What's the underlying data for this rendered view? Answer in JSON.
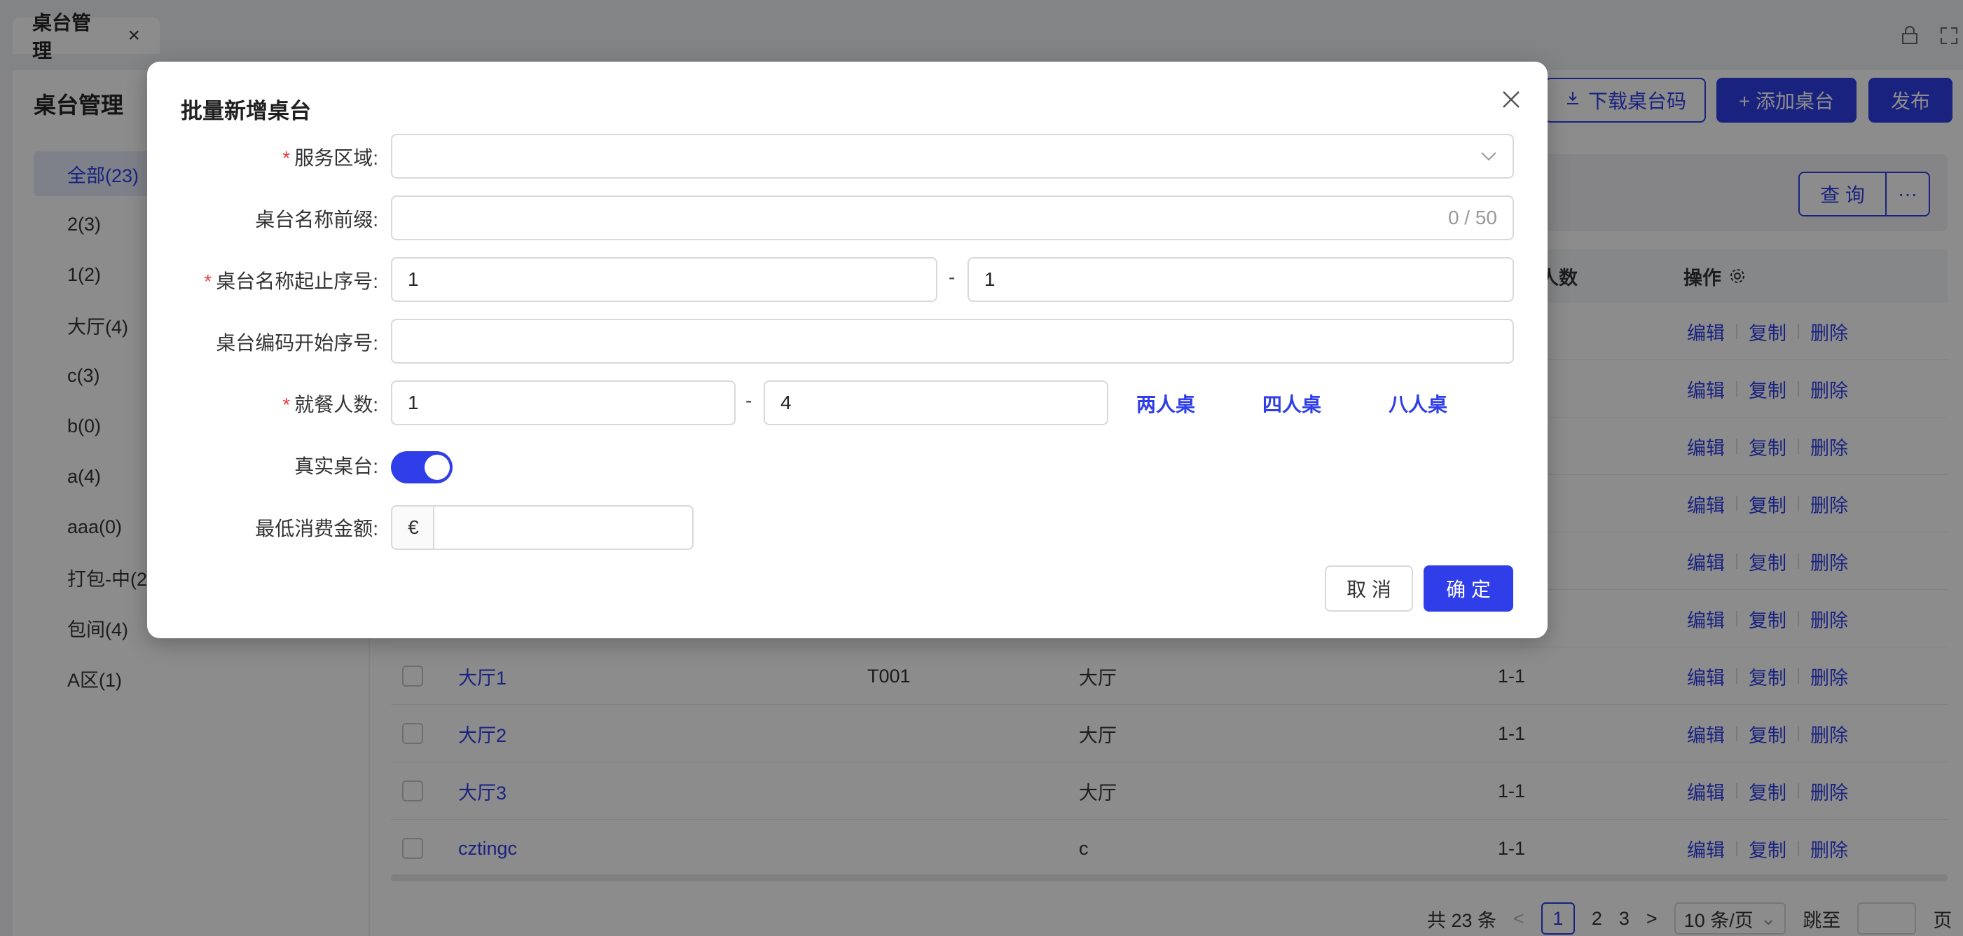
{
  "tabbar": {
    "active_tab": "桌台管理",
    "close_glyph": "×",
    "right_icon_1": "lock-icon",
    "right_icon_2": "fullscreen-icon"
  },
  "sidebar": {
    "title": "桌台管理",
    "items": [
      {
        "label": "全部(23)",
        "active": true
      },
      {
        "label": "2(3)"
      },
      {
        "label": "1(2)"
      },
      {
        "label": "大厅(4)"
      },
      {
        "label": "c(3)"
      },
      {
        "label": "b(0)"
      },
      {
        "label": "a(4)"
      },
      {
        "label": "aaa(0)"
      },
      {
        "label": "打包-中(2"
      },
      {
        "label": "包间(4)"
      },
      {
        "label": "A区(1)"
      }
    ]
  },
  "toolbar": {
    "download_label": "下载桌台码",
    "add_label": "+ 添加桌台",
    "publish_label": "发布"
  },
  "filter": {
    "query_label": "查 询",
    "more_label": "···"
  },
  "table": {
    "headers": {
      "people": "人数",
      "ops": "操作"
    },
    "op_labels": [
      "编辑",
      "复制",
      "删除"
    ],
    "rows": [
      {
        "name": "",
        "code": "",
        "area": "",
        "people": ""
      },
      {
        "name": "",
        "code": "",
        "area": "",
        "people": ""
      },
      {
        "name": "",
        "code": "",
        "area": "",
        "people": ""
      },
      {
        "name": "",
        "code": "",
        "area": "",
        "people": ""
      },
      {
        "name": "",
        "code": "",
        "area": "",
        "people": ""
      },
      {
        "name": "",
        "code": "",
        "area": "",
        "people": ""
      },
      {
        "name": "大厅1",
        "code": "T001",
        "area": "大厅",
        "people": "1-1"
      },
      {
        "name": "大厅2",
        "code": "",
        "area": "大厅",
        "people": "1-1"
      },
      {
        "name": "大厅3",
        "code": "",
        "area": "大厅",
        "people": "1-1"
      },
      {
        "name": "cztingc",
        "code": "",
        "area": "c",
        "people": "1-1"
      }
    ]
  },
  "pagination": {
    "total": "共 23 条",
    "prev": "<",
    "pages": [
      "1",
      "2",
      "3"
    ],
    "current": "1",
    "next": ">",
    "page_size": "10 条/页",
    "jump_label": "跳至",
    "page_suffix": "页"
  },
  "modal": {
    "title": "批量新增桌台",
    "fields": {
      "service_area": {
        "label": "服务区域",
        "required": true,
        "value": ""
      },
      "name_prefix": {
        "label": "桌台名称前缀",
        "required": false,
        "value": "",
        "counter": "0 / 50"
      },
      "name_range": {
        "label": "桌台名称起止序号",
        "required": true,
        "start": "1",
        "end": "1"
      },
      "code_start": {
        "label": "桌台编码开始序号",
        "required": false,
        "value": ""
      },
      "party_size": {
        "label": "就餐人数",
        "required": true,
        "min": "1",
        "max": "4",
        "presets": [
          "两人桌",
          "四人桌",
          "八人桌"
        ]
      },
      "real_table": {
        "label": "真实桌台",
        "value": true
      },
      "min_spend": {
        "label": "最低消费金额",
        "currency": "€",
        "value": ""
      }
    },
    "colon": ":",
    "dash": "-",
    "required_mark": "*",
    "cancel_label": "取 消",
    "ok_label": "确 定"
  },
  "colors": {
    "accent": "#2f3ee8",
    "required": "#e5413f"
  }
}
